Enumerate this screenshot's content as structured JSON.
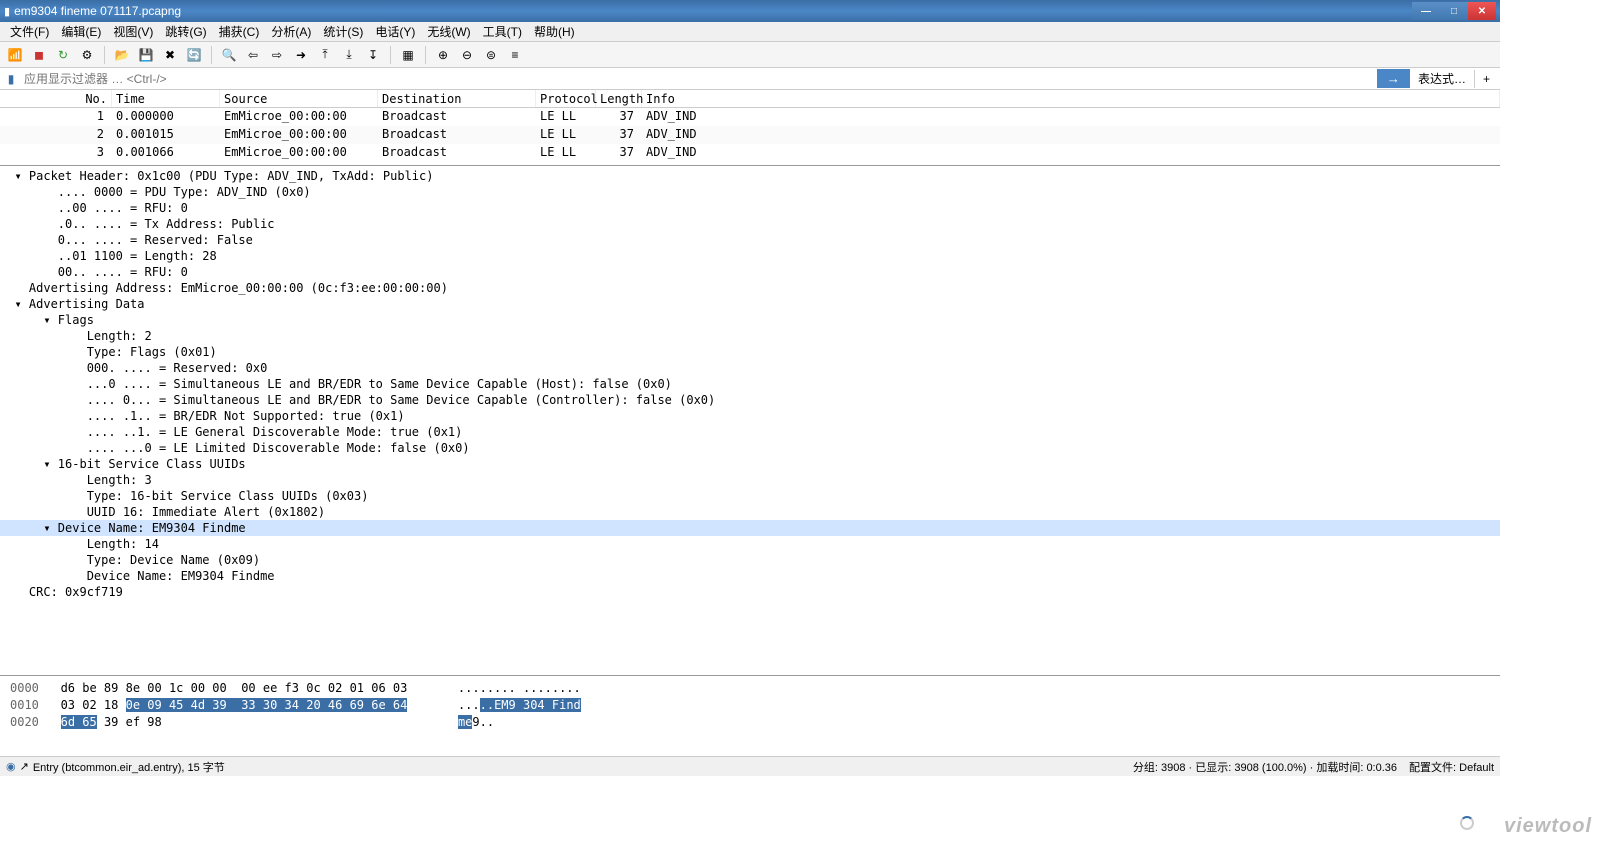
{
  "title": "em9304 fineme 071117.pcapng",
  "menu": [
    "文件(F)",
    "编辑(E)",
    "视图(V)",
    "跳转(G)",
    "捕获(C)",
    "分析(A)",
    "统计(S)",
    "电话(Y)",
    "无线(W)",
    "工具(T)",
    "帮助(H)"
  ],
  "filter_placeholder": "应用显示过滤器 … <Ctrl-/>",
  "filter_apply": "→",
  "filter_expr": "表达式…",
  "columns": {
    "no": "No.",
    "time": "Time",
    "src": "Source",
    "dst": "Destination",
    "proto": "Protocol",
    "len": "Length",
    "info": "Info"
  },
  "packets": [
    {
      "no": "1",
      "time": "0.000000",
      "src": "EmMicroe_00:00:00",
      "dst": "Broadcast",
      "proto": "LE LL",
      "len": "37",
      "info": "ADV_IND"
    },
    {
      "no": "2",
      "time": "0.001015",
      "src": "EmMicroe_00:00:00",
      "dst": "Broadcast",
      "proto": "LE LL",
      "len": "37",
      "info": "ADV_IND"
    },
    {
      "no": "3",
      "time": "0.001066",
      "src": "EmMicroe_00:00:00",
      "dst": "Broadcast",
      "proto": "LE LL",
      "len": "37",
      "info": "ADV_IND"
    }
  ],
  "details": [
    {
      "indent": 1,
      "exp": "open",
      "text": "Packet Header: 0x1c00 (PDU Type: ADV_IND, TxAdd: Public)"
    },
    {
      "indent": 2,
      "text": ".... 0000 = PDU Type: ADV_IND (0x0)"
    },
    {
      "indent": 2,
      "text": "..00 .... = RFU: 0"
    },
    {
      "indent": 2,
      "text": ".0.. .... = Tx Address: Public"
    },
    {
      "indent": 2,
      "text": "0... .... = Reserved: False"
    },
    {
      "indent": 2,
      "text": "..01 1100 = Length: 28"
    },
    {
      "indent": 2,
      "text": "00.. .... = RFU: 0"
    },
    {
      "indent": 1,
      "text": "Advertising Address: EmMicroe_00:00:00 (0c:f3:ee:00:00:00)"
    },
    {
      "indent": 1,
      "exp": "open",
      "text": "Advertising Data"
    },
    {
      "indent": 2,
      "exp": "open",
      "text": "Flags"
    },
    {
      "indent": 3,
      "text": "Length: 2"
    },
    {
      "indent": 3,
      "text": "Type: Flags (0x01)"
    },
    {
      "indent": 3,
      "text": "000. .... = Reserved: 0x0"
    },
    {
      "indent": 3,
      "text": "...0 .... = Simultaneous LE and BR/EDR to Same Device Capable (Host): false (0x0)"
    },
    {
      "indent": 3,
      "text": ".... 0... = Simultaneous LE and BR/EDR to Same Device Capable (Controller): false (0x0)"
    },
    {
      "indent": 3,
      "text": ".... .1.. = BR/EDR Not Supported: true (0x1)"
    },
    {
      "indent": 3,
      "text": ".... ..1. = LE General Discoverable Mode: true (0x1)"
    },
    {
      "indent": 3,
      "text": ".... ...0 = LE Limited Discoverable Mode: false (0x0)"
    },
    {
      "indent": 2,
      "exp": "open",
      "text": "16-bit Service Class UUIDs"
    },
    {
      "indent": 3,
      "text": "Length: 3"
    },
    {
      "indent": 3,
      "text": "Type: 16-bit Service Class UUIDs (0x03)"
    },
    {
      "indent": 3,
      "text": "UUID 16: Immediate Alert (0x1802)"
    },
    {
      "indent": 2,
      "exp": "open",
      "text": "Device Name: EM9304 Findme",
      "selected": true
    },
    {
      "indent": 3,
      "text": "Length: 14"
    },
    {
      "indent": 3,
      "text": "Type: Device Name (0x09)"
    },
    {
      "indent": 3,
      "text": "Device Name: EM9304 Findme"
    },
    {
      "indent": 1,
      "text": "CRC: 0x9cf719"
    }
  ],
  "hex": {
    "rows": [
      {
        "off": "0000",
        "pre": "d6 be 89 8e 00 1c 00 00  00 ee f3 0c 02 01 06 03",
        "sel": "",
        "post": "",
        "apre": "........ ........",
        "asel": "",
        "apost": ""
      },
      {
        "off": "0010",
        "pre": "03 02 18 ",
        "sel": "0e 09 45 4d 39  33 30 34 20 46 69 6e 64",
        "post": "",
        "apre": "...",
        "asel": "..EM9 304 Find",
        "apost": ""
      },
      {
        "off": "0020",
        "pre": "",
        "sel": "6d 65",
        "post": " 39 ef 98",
        "apre": "",
        "asel": "me",
        "apost": "9.."
      }
    ]
  },
  "status": {
    "entry": "Entry (btcommon.eir_ad.entry), 15 字节",
    "right": "分组: 3908 · 已显示: 3908 (100.0%) · 加载时间: 0:0.36",
    "profile": "配置文件: Default"
  },
  "watermark": "viewtool"
}
